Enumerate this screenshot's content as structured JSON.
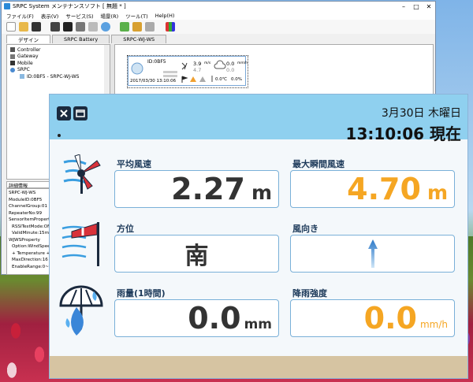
{
  "window": {
    "title": "SRPC System メンテナンスソフト [ 無題 * ]",
    "menu": [
      "ファイル(F)",
      "表示(V)",
      "サービス(S)",
      "場景(R)",
      "ツール(T)",
      "Help(H)"
    ],
    "tabs": [
      "デザイン",
      "SRPC Battery",
      "SRPC-WJ-WS"
    ],
    "active_tab": 0
  },
  "tree": {
    "items": [
      "Controller",
      "Gateway",
      "Mobile",
      "SRPC",
      "ID:0BF5 - SRPC-WJ-WS"
    ]
  },
  "detail": {
    "header": "詳細情報",
    "lines": [
      "SRPC-WJ-WS",
      "ModuleID:0BF5",
      "ChannelGroup:01",
      "RepeaterNo:99",
      "SensorItemProperty",
      "RSSITestMode:ON",
      "ValidMinute:15min",
      "WJWSProperty",
      "Option:WindSpeed",
      "+ Temperature + Hu",
      "MaxDirection:16",
      "EnableRange:0~10"
    ]
  },
  "device_card": {
    "id": "ID:0BF5",
    "wind_speed": "3.9",
    "wind_unit": "m/s",
    "wind_max": "4.7",
    "rain": "0.0",
    "rain_unit": "mm/h",
    "rain2": "0.0",
    "temp": "0.0℃",
    "percent": "0.0%",
    "timestamp": "2017/03/30 13:10:06"
  },
  "panel": {
    "date": "3月30日 木曜日",
    "time": "13:10:06 現在",
    "avg_wind": {
      "label": "平均風速",
      "value": "2.27",
      "unit": "m"
    },
    "max_wind": {
      "label": "最大瞬間風速",
      "value": "4.70",
      "unit": "m"
    },
    "direction": {
      "label": "方位",
      "value": "南"
    },
    "wind_dir": {
      "label": "風向き",
      "angle_deg": 0
    },
    "rain": {
      "label": "雨量(1時間)",
      "value": "0.0",
      "unit": "mm"
    },
    "rain_intensity": {
      "label": "降雨強度",
      "value": "0.0",
      "unit": "mm/h"
    }
  },
  "colors": {
    "accent": "#f5a623",
    "panel_top": "#8fd0ef",
    "dark_value": "#333333",
    "box_border": "#7ab0d8"
  }
}
